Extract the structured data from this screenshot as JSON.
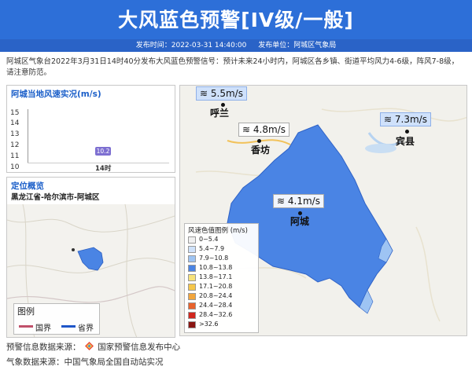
{
  "header": {
    "title": "大风蓝色预警[IV级/一般]",
    "publish_time_label": "发布时间：2022-03-31 14:40:00",
    "publish_unit_label": "发布单位：阿城区气象局"
  },
  "description": "阿城区气象台2022年3月31日14时40分发布大风蓝色预警信号：预计未来24小时内，阿城区各乡镇、街道平均风力4-6级，阵风7-8级，请注意防范。",
  "wind_panel": {
    "title": "阿城当地风速实况(m/s)",
    "y_ticks": [
      "15",
      "14",
      "13",
      "12",
      "11",
      "10"
    ],
    "value_label": "10.2",
    "x_label": "14时"
  },
  "chart_data": {
    "type": "bar",
    "title": "阿城当地风速实况(m/s)",
    "categories": [
      "14时"
    ],
    "values": [
      10.2
    ],
    "ylim": [
      10,
      15
    ]
  },
  "location_panel": {
    "title": "定位概览",
    "path": "黑龙江省-哈尔滨市-阿城区",
    "legend_title": "图例",
    "legend_national": "国界",
    "legend_provincial": "省界"
  },
  "map": {
    "bubbles": [
      {
        "label": "5.5m/s",
        "style": "blue"
      },
      {
        "label": "4.8m/s",
        "style": "white"
      },
      {
        "label": "7.3m/s",
        "style": "blue"
      },
      {
        "label": "4.1m/s",
        "style": "white"
      }
    ],
    "cities": [
      "呼兰",
      "香坊",
      "宾县",
      "阿城"
    ],
    "legend_title": "风速色值图例 (m/s)",
    "legend_items": [
      {
        "label": "0~5.4",
        "color": "#f0f0f0"
      },
      {
        "label": "5.4~7.9",
        "color": "#cfe2fa"
      },
      {
        "label": "7.9~10.8",
        "color": "#9ec4f3"
      },
      {
        "label": "10.8~13.8",
        "color": "#4a84e4"
      },
      {
        "label": "13.8~17.1",
        "color": "#f7e27a"
      },
      {
        "label": "17.1~20.8",
        "color": "#f5c64a"
      },
      {
        "label": "20.8~24.4",
        "color": "#f2a53c"
      },
      {
        "label": "24.4~28.4",
        "color": "#e8622b"
      },
      {
        "label": "28.4~32.6",
        "color": "#d1271e"
      },
      {
        "label": ">32.6",
        "color": "#8a1612"
      }
    ]
  },
  "footer": {
    "warning_source": "预警信息数据来源：",
    "warning_source_name": "国家预警信息发布中心",
    "weather_source": "气象数据来源：中国气象局全国自动站实况"
  },
  "colors": {
    "header_blue": "#2d6fd8",
    "region_blue": "#4a84e4",
    "title_blue": "#1b5fc9"
  }
}
